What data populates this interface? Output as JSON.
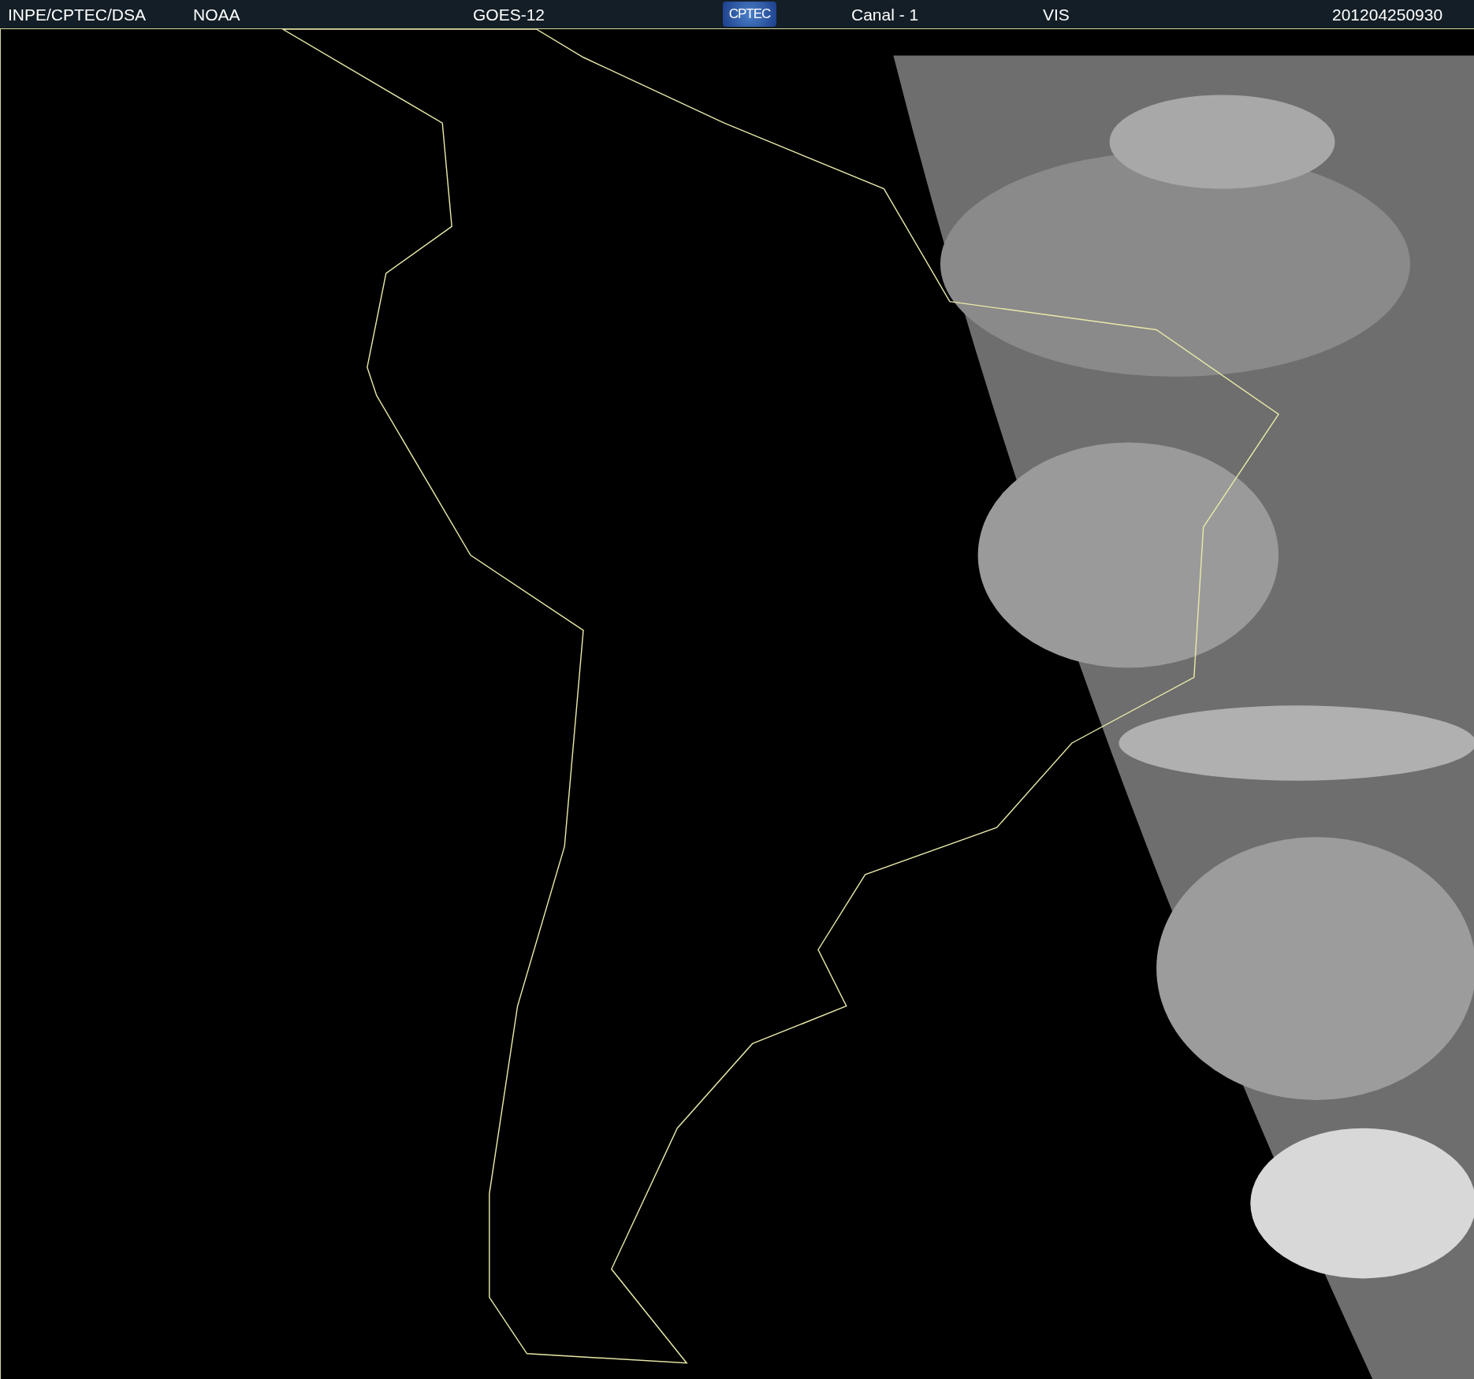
{
  "header": {
    "items": [
      {
        "kind": "text",
        "text": "INPE/CPTEC/DSA"
      },
      {
        "kind": "text",
        "text": "NOAA"
      },
      {
        "kind": "text",
        "text": "GOES-12"
      },
      {
        "kind": "logo",
        "text": "CPTEC"
      },
      {
        "kind": "text",
        "text": "Canal - 1"
      },
      {
        "kind": "text",
        "text": "VIS"
      },
      {
        "kind": "text",
        "text": "201204250930"
      }
    ]
  }
}
